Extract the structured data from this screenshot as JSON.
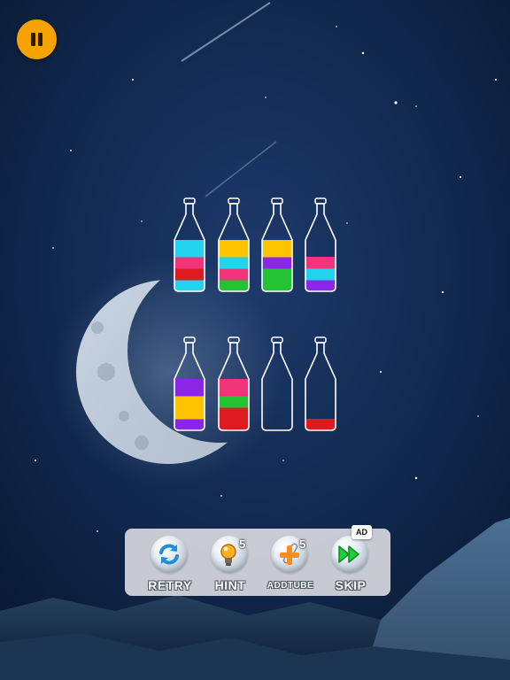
{
  "icons": {
    "pause": "pause-icon",
    "retry": "retry-arrows-icon",
    "hint": "lightbulb-icon",
    "addtube": "add-tube-icon",
    "skip": "fast-forward-icon"
  },
  "colors": {
    "pause_button": "#f6a300",
    "cyan": "#22d3ee",
    "pink": "#f0357a",
    "red": "#dd1a1f",
    "yellow": "#ffc400",
    "green": "#22c232",
    "purple": "#8b26e6"
  },
  "bottles": [
    {
      "layers_bottom_to_top": [
        "cyan",
        "red",
        "pink",
        "cyan"
      ]
    },
    {
      "layers_bottom_to_top": [
        "green",
        "pink",
        "cyan",
        "yellow"
      ]
    },
    {
      "layers_bottom_to_top": [
        "green",
        "green",
        "purple",
        "yellow"
      ]
    },
    {
      "layers_bottom_to_top": [
        "purple",
        "cyan",
        "pink"
      ]
    },
    {
      "layers_bottom_to_top": [
        "purple",
        "yellow",
        "yellow",
        "purple"
      ]
    },
    {
      "layers_bottom_to_top": [
        "red",
        "red",
        "green",
        "pink"
      ]
    },
    {
      "layers_bottom_to_top": []
    },
    {
      "layers_bottom_to_top": [
        "red"
      ]
    }
  ],
  "toolbar": {
    "retry_label": "RETRY",
    "hint_label": "HINT",
    "hint_count": "5",
    "addtube_label": "ADDTUBE",
    "addtube_count": "5",
    "skip_label": "SKIP",
    "skip_badge": "AD"
  }
}
